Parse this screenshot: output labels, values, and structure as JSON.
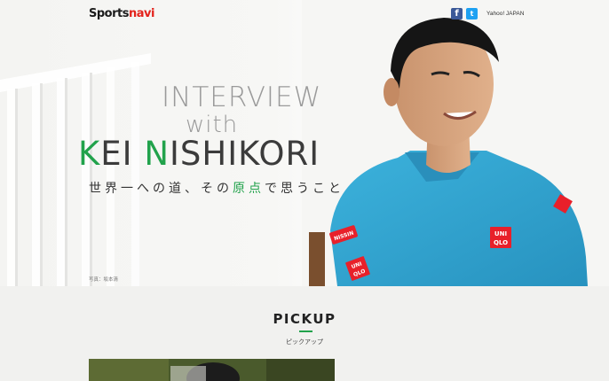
{
  "header": {
    "logo_part1": "Sports",
    "logo_part2": "navi",
    "facebook_glyph": "f",
    "twitter_glyph": "t",
    "yahoo_link": "Yahoo! JAPAN"
  },
  "hero": {
    "title_line1": "INTERVIEW",
    "title_line2": "with",
    "name_first_initial": "K",
    "name_first_rest": "EI ",
    "name_last_initial": "N",
    "name_last_rest": "ISHIKORI",
    "subtitle_before": "世界一への道、その",
    "subtitle_highlight": "原点",
    "subtitle_after": "で思うこと",
    "photo_credit": "写真：坂本清",
    "shirt_logo_top": "UNI",
    "shirt_logo_bottom": "QLO",
    "sleeve_logo_top": "UNI",
    "sleeve_logo_bottom": "QLO",
    "sponsor_patch": "NISSIN"
  },
  "pickup": {
    "title": "PICKUP",
    "subtitle": "ピックアップ"
  },
  "colors": {
    "accent_green": "#21a24b",
    "logo_red": "#e3231c",
    "shirt_blue": "#2fa7d2",
    "facebook": "#3b5998",
    "twitter": "#1da1f2"
  }
}
